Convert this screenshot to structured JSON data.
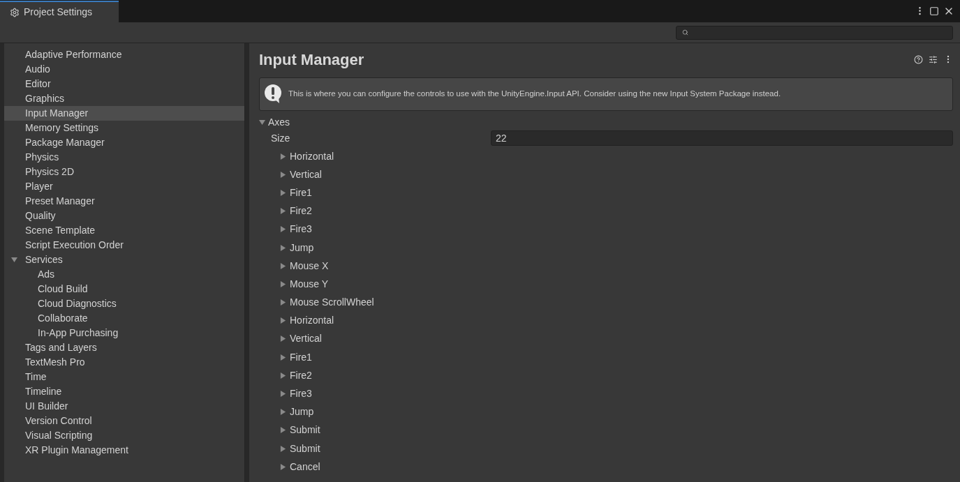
{
  "window": {
    "title": "Project Settings"
  },
  "sidebar": {
    "items": [
      {
        "label": "Adaptive Performance",
        "selected": false
      },
      {
        "label": "Audio",
        "selected": false
      },
      {
        "label": "Editor",
        "selected": false
      },
      {
        "label": "Graphics",
        "selected": false
      },
      {
        "label": "Input Manager",
        "selected": true
      },
      {
        "label": "Memory Settings",
        "selected": false
      },
      {
        "label": "Package Manager",
        "selected": false
      },
      {
        "label": "Physics",
        "selected": false
      },
      {
        "label": "Physics 2D",
        "selected": false
      },
      {
        "label": "Player",
        "selected": false
      },
      {
        "label": "Preset Manager",
        "selected": false
      },
      {
        "label": "Quality",
        "selected": false
      },
      {
        "label": "Scene Template",
        "selected": false
      },
      {
        "label": "Script Execution Order",
        "selected": false
      },
      {
        "label": "Services",
        "selected": false,
        "expanded": true,
        "children": [
          {
            "label": "Ads",
            "selected": false
          },
          {
            "label": "Cloud Build",
            "selected": false
          },
          {
            "label": "Cloud Diagnostics",
            "selected": false
          },
          {
            "label": "Collaborate",
            "selected": false
          },
          {
            "label": "In-App Purchasing",
            "selected": false
          }
        ]
      },
      {
        "label": "Tags and Layers",
        "selected": false
      },
      {
        "label": "TextMesh Pro",
        "selected": false
      },
      {
        "label": "Time",
        "selected": false
      },
      {
        "label": "Timeline",
        "selected": false
      },
      {
        "label": "UI Builder",
        "selected": false
      },
      {
        "label": "Version Control",
        "selected": false
      },
      {
        "label": "Visual Scripting",
        "selected": false
      },
      {
        "label": "XR Plugin Management",
        "selected": false
      }
    ]
  },
  "panel": {
    "title": "Input Manager",
    "help_box": "This is where you can configure the controls to use with the UnityEngine.Input API. Consider using the new Input System Package instead.",
    "axes": {
      "label": "Axes",
      "expanded": true,
      "size_label": "Size",
      "size_value": "22",
      "items": [
        {
          "label": "Horizontal",
          "expanded": false
        },
        {
          "label": "Vertical",
          "expanded": false
        },
        {
          "label": "Fire1",
          "expanded": false
        },
        {
          "label": "Fire2",
          "expanded": false
        },
        {
          "label": "Fire3",
          "expanded": false
        },
        {
          "label": "Jump",
          "expanded": false
        },
        {
          "label": "Mouse X",
          "expanded": false
        },
        {
          "label": "Mouse Y",
          "expanded": false
        },
        {
          "label": "Mouse ScrollWheel",
          "expanded": false
        },
        {
          "label": "Horizontal",
          "expanded": false
        },
        {
          "label": "Vertical",
          "expanded": false
        },
        {
          "label": "Fire1",
          "expanded": false
        },
        {
          "label": "Fire2",
          "expanded": false
        },
        {
          "label": "Fire3",
          "expanded": false
        },
        {
          "label": "Jump",
          "expanded": false
        },
        {
          "label": "Submit",
          "expanded": false
        },
        {
          "label": "Submit",
          "expanded": false
        },
        {
          "label": "Cancel",
          "expanded": false
        }
      ]
    }
  }
}
